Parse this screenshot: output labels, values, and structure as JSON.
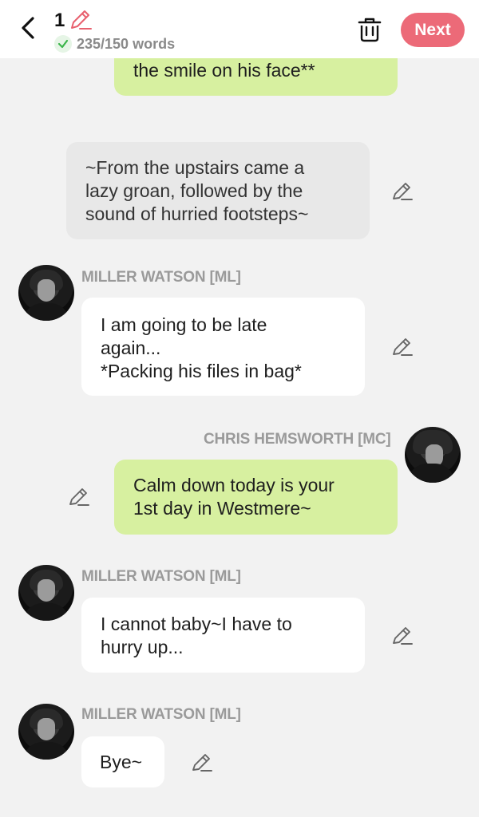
{
  "header": {
    "chapter_number": "1",
    "word_count": "235/150 words",
    "next_label": "Next"
  },
  "colors": {
    "accent": "#ec6a78",
    "mc_bubble": "#d7f0a0",
    "ml_bubble": "#ffffff",
    "narration_bubble": "#e8e8e8"
  },
  "messages": [
    {
      "type": "mc",
      "text": "the smile on his face**"
    },
    {
      "type": "narration",
      "text": "~From the upstairs came a\nlazy groan, followed by the\nsound of hurried footsteps~"
    },
    {
      "type": "ml",
      "name": "MILLER WATSON [ML]",
      "text": "I am going to be late\nagain...\n*Packing his files in bag*"
    },
    {
      "type": "mc",
      "name": "CHRIS HEMSWORTH  [MC]",
      "text": "Calm down today is your\n1st day in Westmere~"
    },
    {
      "type": "ml",
      "name": "MILLER WATSON [ML]",
      "text": "I cannot baby~I have to\nhurry up..."
    },
    {
      "type": "ml",
      "name": "MILLER WATSON [ML]",
      "text": "Bye~"
    }
  ]
}
